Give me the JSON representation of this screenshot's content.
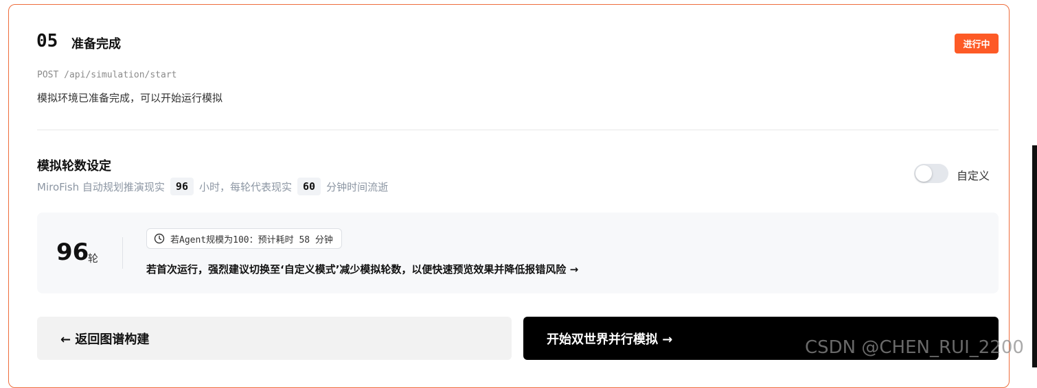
{
  "step": {
    "number": "05",
    "title": "准备完成",
    "status_badge": "进行中",
    "endpoint": "POST /api/simulation/start",
    "description": "模拟环境已准备完成，可以开始运行模拟"
  },
  "rounds_setting": {
    "title": "模拟轮数设定",
    "sub_prefix": "MiroFish 自动规划推演现实",
    "hours": "96",
    "sub_middle": "小时，每轮代表现实",
    "minutes": "60",
    "sub_suffix": "分钟时间流逝",
    "toggle_label": "自定义",
    "toggle_on": false
  },
  "rounds_panel": {
    "value": "96",
    "unit": "轮",
    "estimate": "若Agent规模为100：预计耗时 58 分钟",
    "warning": "若首次运行，强烈建议切换至‘自定义模式’减少模拟轮数，以便快速预览效果并降低报错风险 →"
  },
  "actions": {
    "back_label": "← 返回图谱构建",
    "start_label": "开始双世界并行模拟 →"
  },
  "watermark": "CSDN @CHEN_RUI_2200",
  "icons": {
    "clock": "clock-icon"
  },
  "colors": {
    "accent": "#fd5a26",
    "border": "#ee6b3a"
  }
}
